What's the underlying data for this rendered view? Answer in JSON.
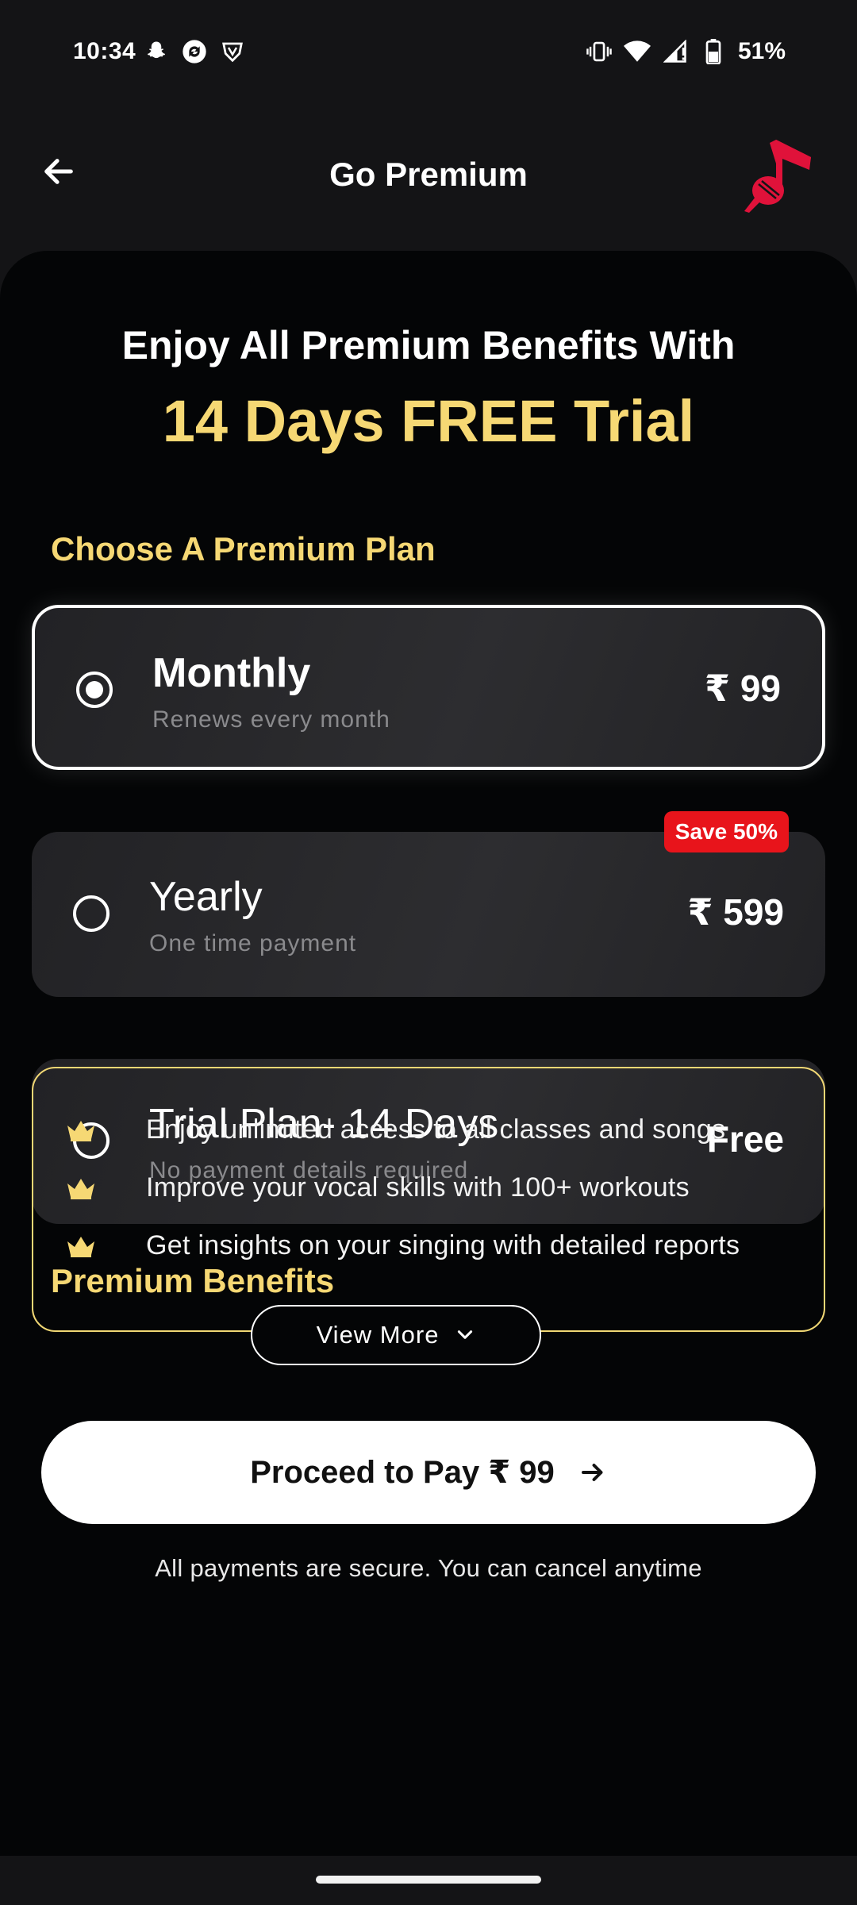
{
  "status_bar": {
    "time": "10:34",
    "left_icons": [
      "snapchat-icon",
      "sync-icon",
      "vpn-shield-icon"
    ],
    "right_icons": [
      "vibrate-icon",
      "wifi-icon",
      "signal-icon",
      "battery-icon"
    ],
    "battery": "51%"
  },
  "header": {
    "title": "Go Premium",
    "back_icon": "arrow-left-icon",
    "logo_icon": "music-note-mic-logo"
  },
  "hero": {
    "line1": "Enjoy All Premium Benefits With",
    "line2": "14 Days FREE Trial"
  },
  "plans_section": {
    "title": "Choose A Premium Plan",
    "plans": [
      {
        "name": "Monthly",
        "sub": "Renews every month",
        "price": "₹ 99",
        "selected": true,
        "badge": ""
      },
      {
        "name": "Yearly",
        "sub": "One time payment",
        "price": "₹ 599",
        "selected": false,
        "badge": "Save 50%"
      },
      {
        "name": "Trial Plan- 14 Days",
        "sub": "No payment details required",
        "price": "Free",
        "selected": false,
        "badge": ""
      }
    ]
  },
  "benefits_section": {
    "title": "Premium Benefits",
    "items": [
      "Enjoy unlimited access to all classes and songs",
      "Improve your vocal skills with 100+ workouts",
      "Get insights on your singing with detailed reports"
    ],
    "view_more": "View More"
  },
  "cta": {
    "label": "Proceed to Pay ₹ 99",
    "note": "All payments are secure. You can cancel anytime"
  },
  "colors": {
    "accent_gold": "#f6d874",
    "badge_red": "#e8141b",
    "logo_red": "#e0123a",
    "background": "#040506"
  }
}
